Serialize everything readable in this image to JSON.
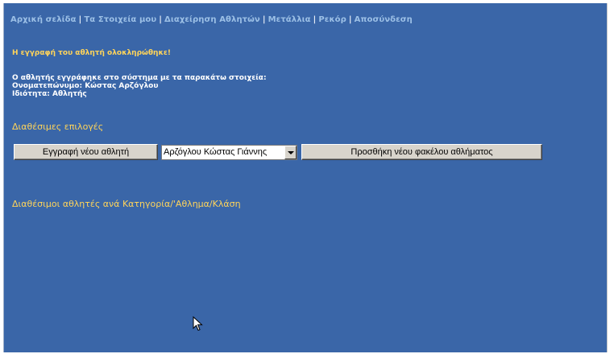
{
  "nav": {
    "items": [
      "Αρχική σελίδα",
      "Τα Στοιχεία μου",
      "Διαχείρηση Αθλητών",
      "Μετάλλια",
      "Ρεκόρ",
      "Αποσύνδεση"
    ],
    "separator": "|"
  },
  "message": {
    "success": "Η εγγραφή του αθλητή ολοκληρώθηκε!",
    "line1": "Ο αθλητής εγγράφηκε στο σύστημα με τα παρακάτω στοιχεία:",
    "line2": "Ονοματεπώνυμο: Κώστας Αρζόγλου",
    "line3": "Ιδιότητα: Αθλητής"
  },
  "options": {
    "title": "Διαθέσιμες επιλογές",
    "register_button": "Εγγραφή νέου αθλητή",
    "athlete_select_value": "Αρζόγλου Κώστας Γιάννης",
    "add_folder_button": "Προσθήκη νέου φακέλου αθλήματος"
  },
  "athletes_section": {
    "title": "Διαθέσιμοι αθλητές ανά Κατηγορία/'Αθλημα/Κλάση"
  },
  "colors": {
    "background": "#3a66a8",
    "nav_link": "#9cc0e6",
    "heading": "#ffd45a"
  }
}
